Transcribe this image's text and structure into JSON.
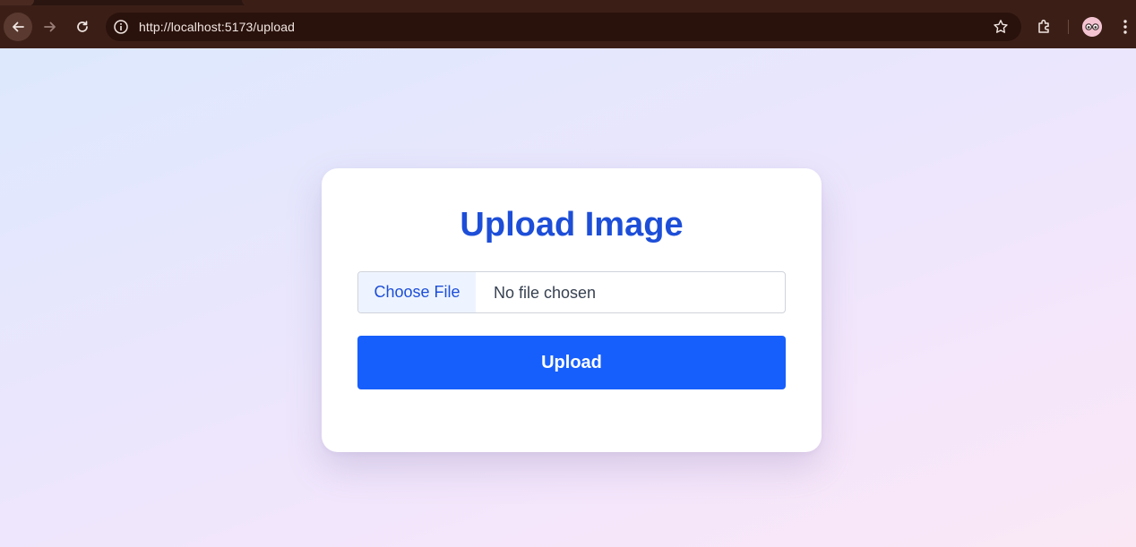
{
  "browser": {
    "url": "http://localhost:5173/upload",
    "icons": {
      "back": "back-arrow-icon",
      "forward": "forward-arrow-icon",
      "reload": "reload-icon",
      "site_info": "info-icon",
      "bookmark": "star-icon",
      "extensions": "puzzle-icon",
      "profile": "avatar",
      "menu": "kebab-menu-icon"
    }
  },
  "upload_form": {
    "title": "Upload Image",
    "file_button_label": "Choose File",
    "file_status": "No file chosen",
    "submit_label": "Upload"
  },
  "colors": {
    "accent": "#1d4ed8",
    "button": "#175ffc",
    "chrome": "#3b1f17"
  }
}
